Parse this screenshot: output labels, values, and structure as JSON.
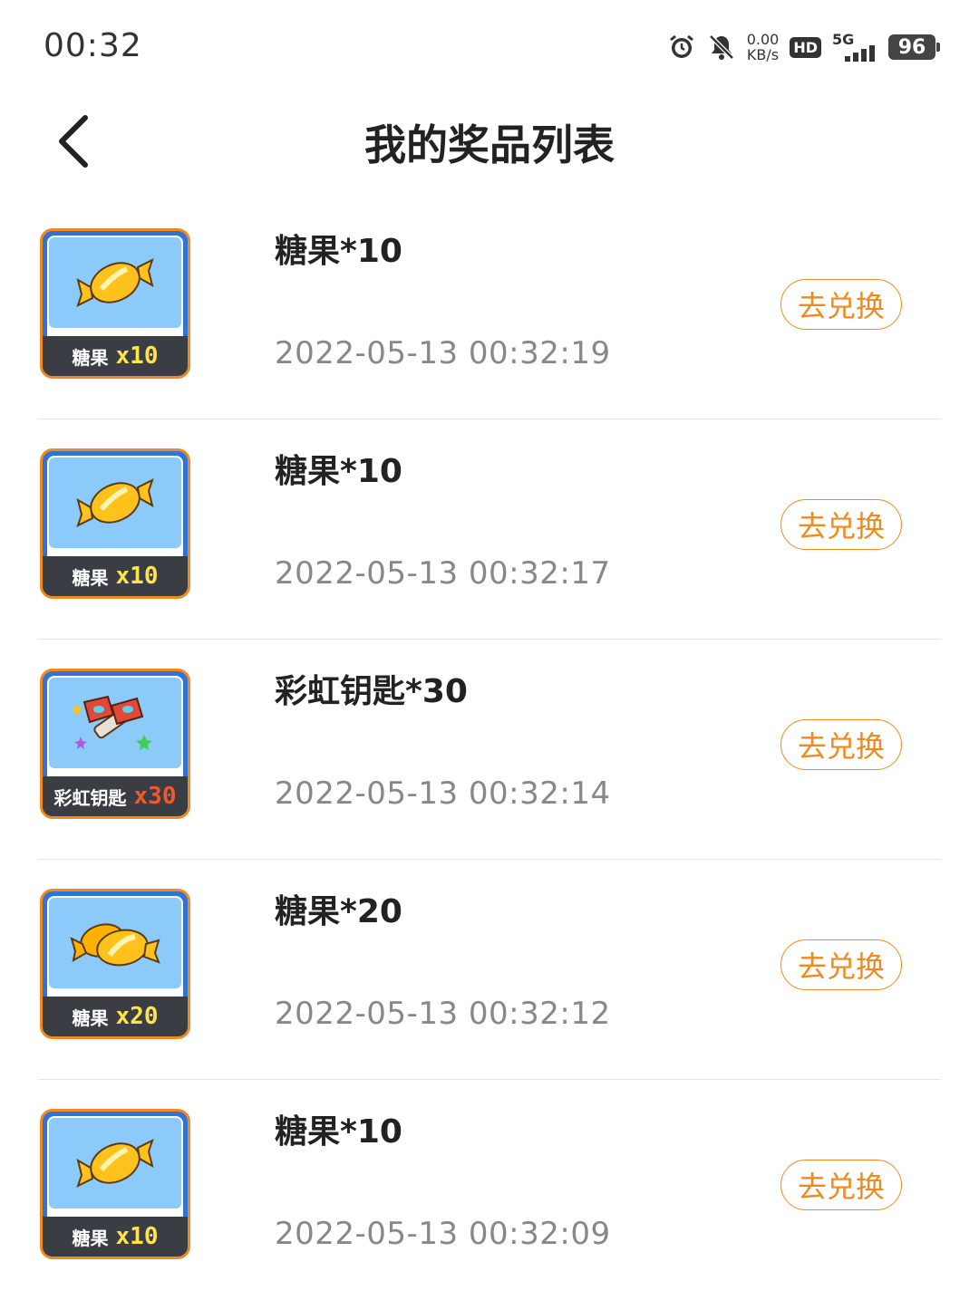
{
  "status_bar": {
    "time": "00:32",
    "net_speed_value": "0.00",
    "net_speed_unit": "KB/s",
    "hd_label": "HD",
    "signal_label": "5G",
    "battery_level": "96"
  },
  "header": {
    "title": "我的奖品列表"
  },
  "prizes": [
    {
      "title": "糖果*10",
      "time": "2022-05-13 00:32:19",
      "button": "去兑换",
      "thumb_name": "糖果",
      "thumb_qty": "x10",
      "icon": "candy-icon"
    },
    {
      "title": "糖果*10",
      "time": "2022-05-13 00:32:17",
      "button": "去兑换",
      "thumb_name": "糖果",
      "thumb_qty": "x10",
      "icon": "candy-icon"
    },
    {
      "title": "彩虹钥匙*30",
      "time": "2022-05-13 00:32:14",
      "button": "去兑换",
      "thumb_name": "彩虹钥匙",
      "thumb_qty": "x30",
      "icon": "rainbow-key-icon"
    },
    {
      "title": "糖果*20",
      "time": "2022-05-13 00:32:12",
      "button": "去兑换",
      "thumb_name": "糖果",
      "thumb_qty": "x20",
      "icon": "double-candy-icon"
    },
    {
      "title": "糖果*10",
      "time": "2022-05-13 00:32:09",
      "button": "去兑换",
      "thumb_name": "糖果",
      "thumb_qty": "x10",
      "icon": "candy-icon"
    }
  ],
  "colors": {
    "accent": "#f08a1e",
    "thumb_sky": "#8ccafa",
    "thumb_frame": "#2f73d6",
    "candy": "#ffc21c"
  }
}
